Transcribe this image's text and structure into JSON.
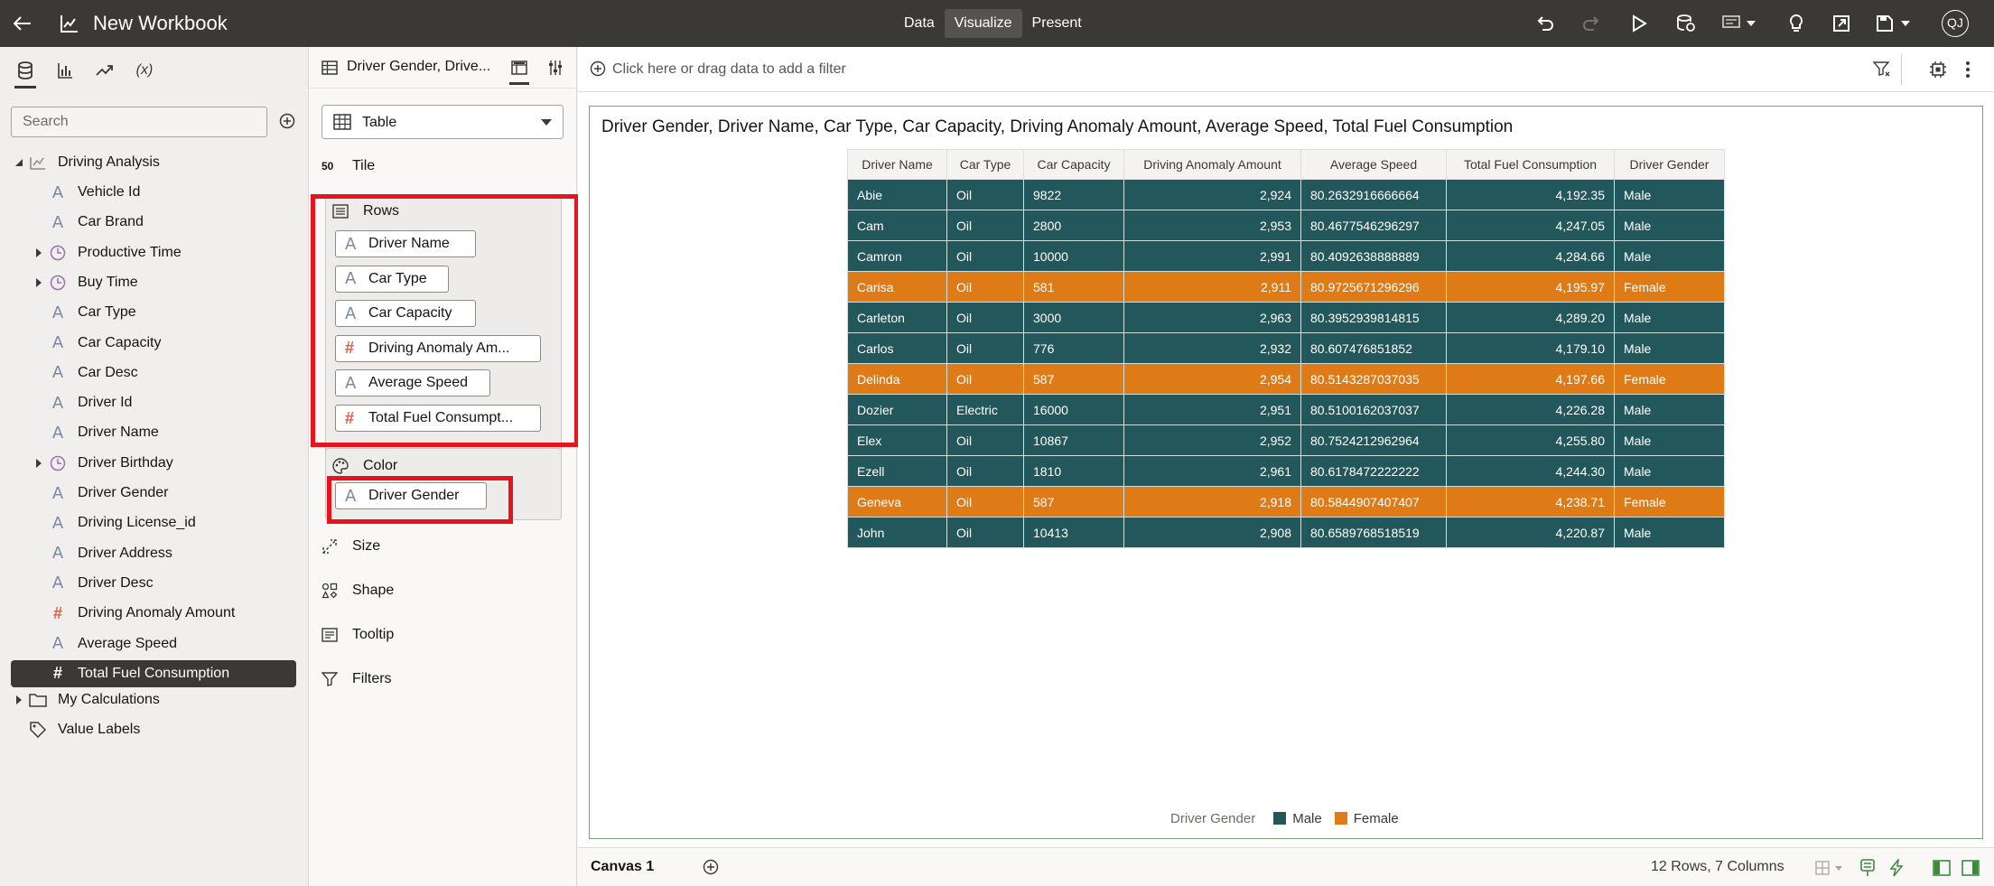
{
  "app": {
    "title": "New Workbook",
    "modes": [
      "Data",
      "Visualize",
      "Present"
    ],
    "active_mode": "Visualize",
    "user_initials": "QJ"
  },
  "data_panel": {
    "tabs": [
      "data-tab",
      "visualizations-tab",
      "analytics-tab",
      "calculations-tab"
    ],
    "calc_tab_label": "(x)",
    "search_placeholder": "Search",
    "dataset_name": "Driving Analysis",
    "items": [
      {
        "label": "Vehicle Id",
        "type": "attribute"
      },
      {
        "label": "Car Brand",
        "type": "attribute"
      },
      {
        "label": "Productive Time",
        "type": "time",
        "expandable": true
      },
      {
        "label": "Buy Time",
        "type": "time",
        "expandable": true
      },
      {
        "label": "Car Type",
        "type": "attribute"
      },
      {
        "label": "Car Capacity",
        "type": "attribute"
      },
      {
        "label": "Car Desc",
        "type": "attribute"
      },
      {
        "label": "Driver Id",
        "type": "attribute"
      },
      {
        "label": "Driver Name",
        "type": "attribute"
      },
      {
        "label": "Driver Birthday",
        "type": "time",
        "expandable": true
      },
      {
        "label": "Driver Gender",
        "type": "attribute"
      },
      {
        "label": "Driving License_id",
        "type": "attribute"
      },
      {
        "label": "Driver Address",
        "type": "attribute"
      },
      {
        "label": "Driver Desc",
        "type": "attribute"
      },
      {
        "label": "Driving Anomaly Amount",
        "type": "measure"
      },
      {
        "label": "Average Speed",
        "type": "attribute"
      },
      {
        "label": "Total Fuel Consumption",
        "type": "measure",
        "selected": true
      }
    ],
    "my_calculations": "My Calculations",
    "value_labels": "Value Labels"
  },
  "grammar": {
    "viz_name": "Driver Gender, Drive...",
    "viz_type": "Table",
    "tile_label": "Tile",
    "tile_icon_text": "50",
    "rows_label": "Rows",
    "rows": [
      {
        "label": "Driver Name",
        "type": "attribute"
      },
      {
        "label": "Car Type",
        "type": "attribute"
      },
      {
        "label": "Car Capacity",
        "type": "attribute"
      },
      {
        "label": "Driving Anomaly Am...",
        "type": "measure"
      },
      {
        "label": "Average Speed",
        "type": "attribute"
      },
      {
        "label": "Total Fuel Consumpt...",
        "type": "measure"
      }
    ],
    "color_label": "Color",
    "color_pill": "Driver Gender",
    "size_label": "Size",
    "shape_label": "Shape",
    "tooltip_label": "Tooltip",
    "filters_label": "Filters"
  },
  "filter_bar": {
    "placeholder": "Click here or drag data to add a filter"
  },
  "viz": {
    "title": "Driver Gender, Driver Name, Car Type, Car Capacity, Driving Anomaly Amount, Average Speed, Total Fuel Consumption",
    "columns": [
      "Driver Name",
      "Car Type",
      "Car Capacity",
      "Driving Anomaly Amount",
      "Average Speed",
      "Total Fuel Consumption",
      "Driver Gender"
    ],
    "rows": [
      [
        "Abie",
        "Oil",
        "9822",
        "2,924",
        "80.2632916666664",
        "4,192.35",
        "Male"
      ],
      [
        "Cam",
        "Oil",
        "2800",
        "2,953",
        "80.4677546296297",
        "4,247.05",
        "Male"
      ],
      [
        "Camron",
        "Oil",
        "10000",
        "2,991",
        "80.4092638888889",
        "4,284.66",
        "Male"
      ],
      [
        "Carisa",
        "Oil",
        "581",
        "2,911",
        "80.9725671296296",
        "4,195.97",
        "Female"
      ],
      [
        "Carleton",
        "Oil",
        "3000",
        "2,963",
        "80.3952939814815",
        "4,289.20",
        "Male"
      ],
      [
        "Carlos",
        "Oil",
        "776",
        "2,932",
        "80.607476851852",
        "4,179.10",
        "Male"
      ],
      [
        "Delinda",
        "Oil",
        "587",
        "2,954",
        "80.5143287037035",
        "4,197.66",
        "Female"
      ],
      [
        "Dozier",
        "Electric",
        "16000",
        "2,951",
        "80.5100162037037",
        "4,226.28",
        "Male"
      ],
      [
        "Elex",
        "Oil",
        "10867",
        "2,952",
        "80.7524212962964",
        "4,255.80",
        "Male"
      ],
      [
        "Ezell",
        "Oil",
        "1810",
        "2,961",
        "80.6178472222222",
        "4,244.30",
        "Male"
      ],
      [
        "Geneva",
        "Oil",
        "587",
        "2,918",
        "80.5844907407407",
        "4,238.71",
        "Female"
      ],
      [
        "John",
        "Oil",
        "10413",
        "2,908",
        "80.6589768518519",
        "4,220.87",
        "Male"
      ]
    ],
    "legend_title": "Driver Gender",
    "legend": [
      {
        "label": "Male",
        "color": "#22575c"
      },
      {
        "label": "Female",
        "color": "#df7b16"
      }
    ]
  },
  "bottom": {
    "canvas_tab": "Canvas 1",
    "row_count": "12 Rows, 7 Columns"
  },
  "colors": {
    "topbar": "#3a3936",
    "highlight": "#e8141b",
    "male": "#22575c",
    "female": "#df7b16"
  }
}
